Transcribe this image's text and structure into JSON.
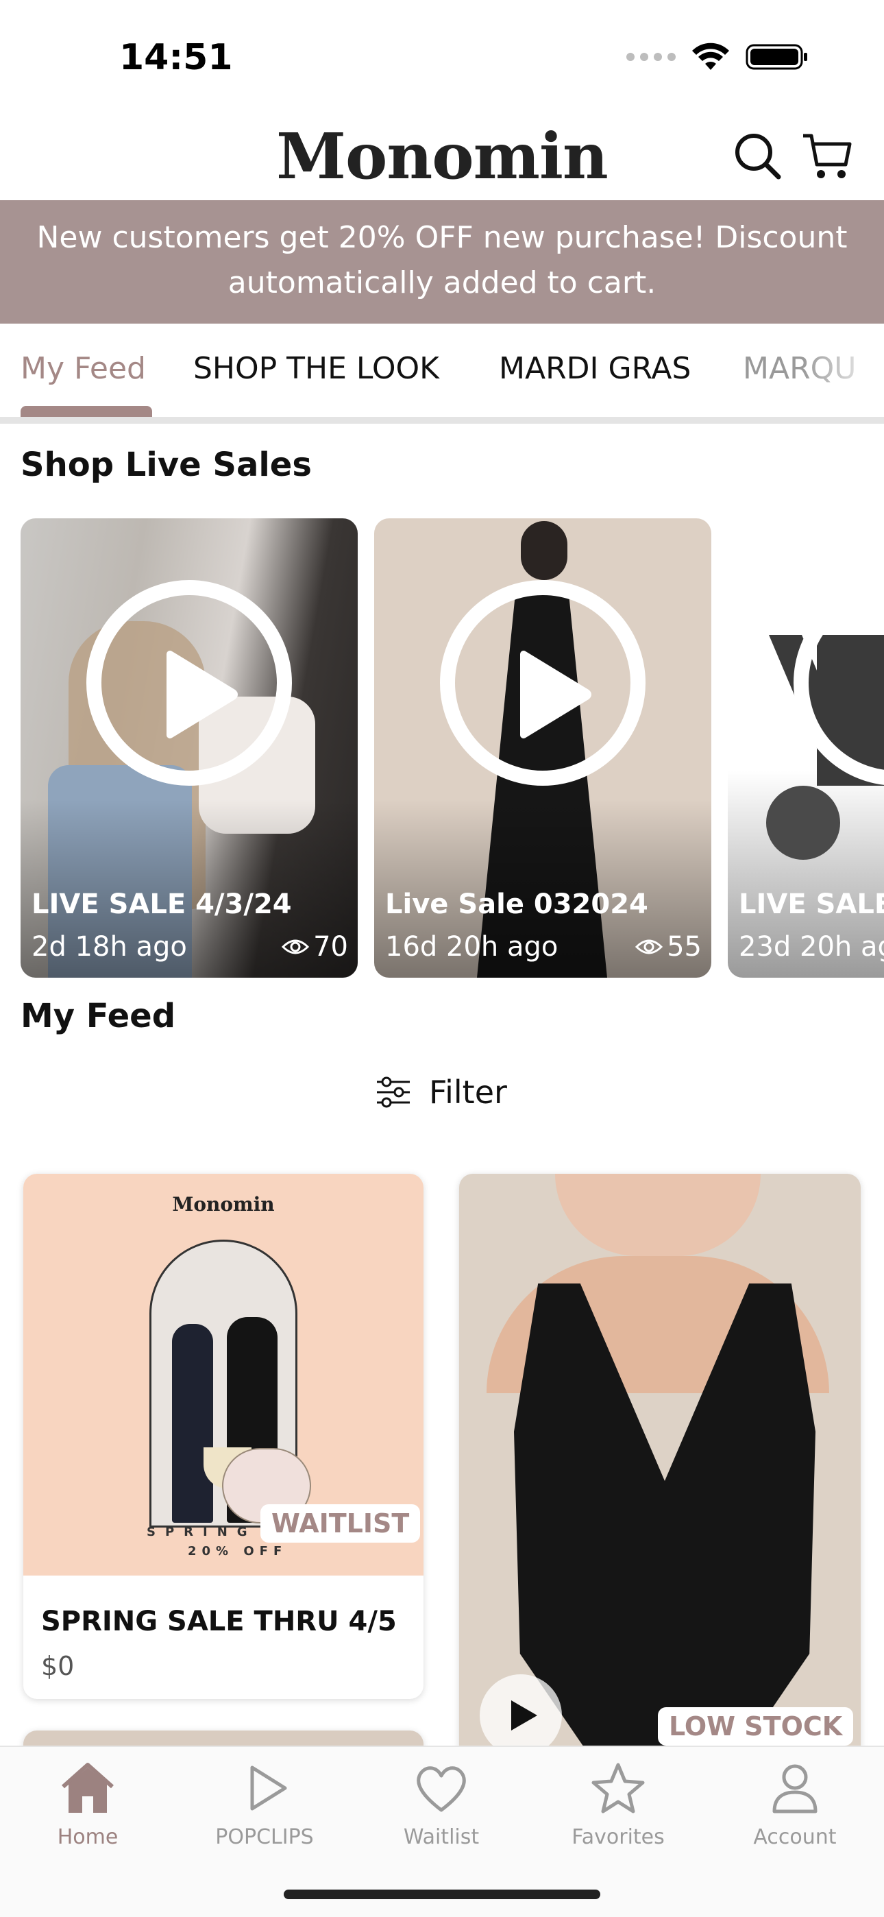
{
  "status_bar": {
    "time": "14:51"
  },
  "header": {
    "brand": "Monomin",
    "search_icon": "search-icon",
    "cart_icon": "cart-icon"
  },
  "promo": {
    "line1": "New customers get 20% OFF new purchase!  Discount",
    "line2": "automatically added to cart."
  },
  "tabs": [
    {
      "label": "My Feed",
      "active": true
    },
    {
      "label": "SHOP THE LOOK"
    },
    {
      "label": "MARDI GRAS"
    },
    {
      "label": "MARQU"
    }
  ],
  "live_sales": {
    "title": "Shop Live Sales",
    "items": [
      {
        "title": "LIVE SALE 4/3/24",
        "ago": "2d 18h ago",
        "views": "70"
      },
      {
        "title": "Live Sale 032024",
        "ago": "16d 20h ago",
        "views": "55"
      },
      {
        "title": "LIVE SALE",
        "ago": "23d 20h ag"
      }
    ]
  },
  "feed": {
    "title": "My Feed",
    "filter_label": "Filter",
    "items": [
      {
        "image_brand": "Monomin",
        "image_caption_1": "SPRING S",
        "image_caption_2": "20% OFF",
        "badge": "WAITLIST",
        "title": "SPRING SALE THRU 4/5",
        "price": "$0"
      },
      {
        "badge": "LOW STOCK"
      }
    ]
  },
  "bottom_nav": [
    {
      "label": "Home",
      "icon": "home-icon",
      "active": true
    },
    {
      "label": "POPCLIPS",
      "icon": "play-icon"
    },
    {
      "label": "Waitlist",
      "icon": "heart-icon"
    },
    {
      "label": "Favorites",
      "icon": "star-icon"
    },
    {
      "label": "Account",
      "icon": "person-icon"
    }
  ],
  "colors": {
    "accent": "#a48886",
    "promo_bg": "#a79392"
  }
}
